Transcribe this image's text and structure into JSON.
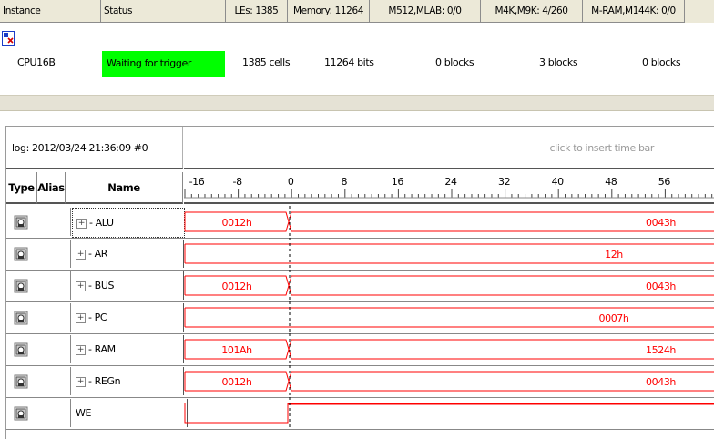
{
  "instance_table": {
    "headers": {
      "instance": "Instance",
      "status": "Status",
      "les": "LEs: 1385",
      "memory": "Memory: 11264",
      "m512": "M512,MLAB: 0/0",
      "m4k": "M4K,M9K: 4/260",
      "mram": "M-RAM,M144K: 0/0"
    },
    "row": {
      "instance": "CPU16B",
      "status": "Waiting for trigger",
      "les": "1385 cells",
      "memory": "11264 bits",
      "m512": "0 blocks",
      "m4k": "3 blocks",
      "mram": "0 blocks"
    },
    "status_color": "#00ff00"
  },
  "waveform": {
    "log_label": "log: 2012/03/24 21:36:09  #0",
    "time_bar_hint": "click to insert time bar",
    "columns": {
      "type": "Type",
      "alias": "Alias",
      "name": "Name"
    },
    "ruler_ticks": [
      "-16",
      "-8",
      "0",
      "8",
      "16",
      "24",
      "32",
      "40",
      "48",
      "56"
    ],
    "signal_color": "#ff0000",
    "signals": [
      {
        "name": "ALU",
        "bus": true,
        "before": "0012h",
        "after": "0043h",
        "transition": true
      },
      {
        "name": "AR",
        "bus": true,
        "before": "",
        "after": "12h",
        "transition": false
      },
      {
        "name": "BUS",
        "bus": true,
        "before": "0012h",
        "after": "0043h",
        "transition": true
      },
      {
        "name": "PC",
        "bus": true,
        "before": "",
        "after": "0007h",
        "transition": false
      },
      {
        "name": "RAM",
        "bus": true,
        "before": "101Ah",
        "after": "1524h",
        "transition": true
      },
      {
        "name": "REGn",
        "bus": true,
        "before": "0012h",
        "after": "0043h",
        "transition": true
      },
      {
        "name": "WE",
        "bus": false,
        "before": "",
        "after": "",
        "transition": true
      }
    ]
  }
}
